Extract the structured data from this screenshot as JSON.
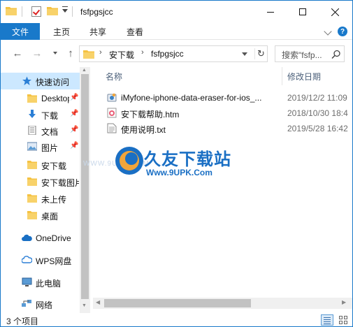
{
  "window": {
    "title": "fsfpgsjcc"
  },
  "ribbon": {
    "tabs": [
      {
        "label": "文件"
      },
      {
        "label": "主页"
      },
      {
        "label": "共享"
      },
      {
        "label": "查看"
      }
    ],
    "help": "?"
  },
  "address": {
    "segments": [
      "安下载",
      "fsfpgsjcc"
    ],
    "refresh_glyph": "↻"
  },
  "search": {
    "placeholder": "搜索\"fsfp..."
  },
  "nav": {
    "quick_access": "快速访问",
    "items": [
      {
        "label": "Desktop",
        "icon": "desktop-folder-icon",
        "pinned": true
      },
      {
        "label": "下载",
        "icon": "download-arrow-icon",
        "pinned": true
      },
      {
        "label": "文档",
        "icon": "documents-icon",
        "pinned": true
      },
      {
        "label": "图片",
        "icon": "pictures-icon",
        "pinned": true
      },
      {
        "label": "安下载",
        "icon": "folder-icon",
        "pinned": false
      },
      {
        "label": "安下载图片",
        "icon": "folder-icon",
        "pinned": false
      },
      {
        "label": "未上传",
        "icon": "folder-icon",
        "pinned": false
      },
      {
        "label": "桌面",
        "icon": "folder-icon",
        "pinned": false
      }
    ],
    "roots": [
      {
        "label": "OneDrive",
        "icon": "onedrive-cloud-icon"
      },
      {
        "label": "WPS网盘",
        "icon": "wps-cloud-icon"
      },
      {
        "label": "此电脑",
        "icon": "this-pc-icon"
      },
      {
        "label": "网络",
        "icon": "network-icon"
      }
    ]
  },
  "columns": {
    "name": "名称",
    "date": "修改日期"
  },
  "files": [
    {
      "name": "iMyfone-iphone-data-eraser-for-ios_...",
      "date": "2019/12/2 11:09",
      "icon": "installer-exe-icon"
    },
    {
      "name": "安下载帮助.htm",
      "date": "2018/10/30 18:4",
      "icon": "htm-file-icon"
    },
    {
      "name": "使用说明.txt",
      "date": "2019/5/28 16:42",
      "icon": "txt-file-icon"
    }
  ],
  "watermark": {
    "brand": "久友下载站",
    "url": "Www.9UPK.Com",
    "faint": "WWW.9UPK.COM"
  },
  "status": {
    "count": "3 个项目"
  },
  "colors": {
    "accent": "#1979ca",
    "selection": "#cce8ff",
    "folder": "#f5c242"
  }
}
